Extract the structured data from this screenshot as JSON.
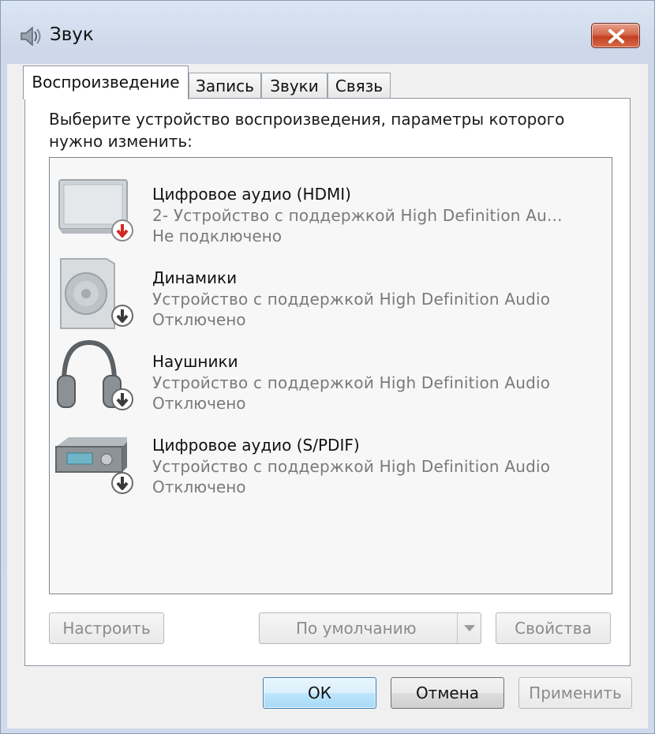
{
  "window": {
    "title": "Звук",
    "title_icon": "speaker-icon",
    "close_icon": "close-icon"
  },
  "tabs": [
    {
      "label": "Воспроизведение",
      "active": true
    },
    {
      "label": "Запись",
      "active": false
    },
    {
      "label": "Звуки",
      "active": false
    },
    {
      "label": "Связь",
      "active": false
    }
  ],
  "playback": {
    "instruction": "Выберите устройство воспроизведения, параметры которого нужно изменить:",
    "devices": [
      {
        "name": "Цифровое аудио (HDMI)",
        "description": "2- Устройство с поддержкой High Definition Au...",
        "status": "Не подключено",
        "icon": "monitor-icon",
        "badge": "red-down-arrow-icon"
      },
      {
        "name": "Динамики",
        "description": "Устройство с поддержкой High Definition Audio",
        "status": "Отключено",
        "icon": "speaker-box-icon",
        "badge": "gray-down-arrow-icon"
      },
      {
        "name": "Наушники",
        "description": "Устройство с поддержкой High Definition Audio",
        "status": "Отключено",
        "icon": "headphones-icon",
        "badge": "gray-down-arrow-icon"
      },
      {
        "name": "Цифровое аудио (S/PDIF)",
        "description": "Устройство с поддержкой High Definition Audio",
        "status": "Отключено",
        "icon": "receiver-icon",
        "badge": "gray-down-arrow-icon"
      }
    ],
    "configure_label": "Настроить",
    "default_label": "По умолчанию",
    "properties_label": "Свойства"
  },
  "footer": {
    "ok_label": "ОК",
    "cancel_label": "Отмена",
    "apply_label": "Применить"
  },
  "colors": {
    "accent": "#3c7fb1",
    "close": "#c2401f",
    "disabled_text": "#8b8b8b",
    "badge_red": "#d22a22"
  }
}
